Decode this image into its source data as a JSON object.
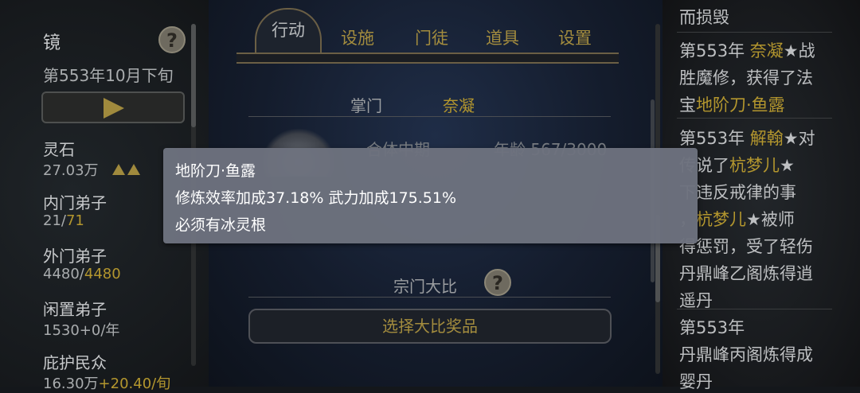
{
  "left_panel": {
    "title": "镜",
    "date": "第553年10月下旬",
    "stats": [
      {
        "label": "灵石",
        "value": "27.03万",
        "extra": ""
      },
      {
        "label": "内门弟子",
        "value": "21/",
        "extra": "71"
      },
      {
        "label": "外门弟子",
        "value": "4480/",
        "extra": "4480"
      },
      {
        "label": "闲置弟子",
        "value": "1530+0/年",
        "extra": ""
      },
      {
        "label": "庇护民众",
        "value": "16.30万",
        "extra": "+20.40/旬"
      }
    ]
  },
  "tabs": [
    "行动",
    "设施",
    "门徒",
    "道具",
    "设置"
  ],
  "center": {
    "leader_label": "掌门",
    "leader_name": "奈凝",
    "realm": "合体中期",
    "age": "年龄 567/3000",
    "competition_title": "宗门大比",
    "reward_button": "选择大比奖品"
  },
  "tooltip": {
    "name": "地阶刀·鱼露",
    "effect": "修炼效率加成37.18% 武力加成175.51%",
    "requirement": "必须有冰灵根"
  },
  "log": [
    [
      {
        "t": "而损毁",
        "g": false
      }
    ],
    [
      {
        "t": "第553年 ",
        "g": false
      },
      {
        "t": "奈凝",
        "g": true
      },
      {
        "t": "★战",
        "g": false
      }
    ],
    [
      {
        "t": "胜魔修，获得了法",
        "g": false
      }
    ],
    [
      {
        "t": "宝",
        "g": false
      },
      {
        "t": "地阶刀·鱼露",
        "g": true
      }
    ],
    [
      {
        "t": "第553年 ",
        "g": false
      },
      {
        "t": "解翰",
        "g": true
      },
      {
        "t": "★对",
        "g": false
      }
    ],
    [
      {
        "t": "传说了",
        "g": false
      },
      {
        "t": "杭梦儿",
        "g": true
      },
      {
        "t": "★",
        "g": false
      }
    ],
    [
      {
        "t": "下违反戒律的事",
        "g": false
      }
    ],
    [
      {
        "t": "，",
        "g": false
      },
      {
        "t": "杭梦儿",
        "g": true
      },
      {
        "t": "★被师",
        "g": false
      }
    ],
    [
      {
        "t": "得惩罚，受了轻伤",
        "g": false
      }
    ],
    [
      {
        "t": "丹鼎峰乙阁炼得逍",
        "g": false
      }
    ],
    [
      {
        "t": "遥丹",
        "g": false
      }
    ],
    [
      {
        "t": "第553年",
        "g": false
      }
    ],
    [
      {
        "t": "丹鼎峰丙阁炼得成",
        "g": false
      }
    ],
    [
      {
        "t": "婴丹",
        "g": false
      }
    ]
  ]
}
